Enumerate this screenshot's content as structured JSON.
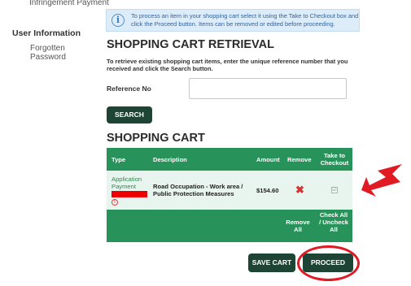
{
  "sidebar": {
    "cut_item": "Infringement Payment",
    "section_title": "User Information",
    "link": "Forgotten Password"
  },
  "info": {
    "icon": "info-icon",
    "text": "To process an item in your shopping cart select it using the Take to Checkout box and click the Proceed button. Items can be removed or edited before proceeding."
  },
  "retrieval": {
    "title": "SHOPPING CART RETRIEVAL",
    "instructions": "To retrieve existing shopping cart items, enter the unique reference number that you received and click the Search button.",
    "ref_label": "Reference No",
    "ref_value": "",
    "search_label": "SEARCH"
  },
  "cart": {
    "title": "SHOPPING CART",
    "headers": {
      "type": "Type",
      "description": "Description",
      "amount": "Amount",
      "remove": "Remove",
      "checkout": "Take to Checkout"
    },
    "row": {
      "type": "Application Payment",
      "description": "Road Occupation - Work area / Public Protection Measures",
      "amount": "$154.60",
      "remove": "✖",
      "checkbox": "☑",
      "warn_icon": "warning-icon"
    },
    "footer": {
      "remove_all": "Remove All",
      "check_all": "Check All / Uncheck All"
    },
    "save_label": "SAVE CART",
    "proceed_label": "PROCEED"
  },
  "colors": {
    "table_green": "#27935a",
    "button_dark": "#1e4436",
    "annotation_red": "#e01b24",
    "info_bg": "#dcecf8"
  }
}
